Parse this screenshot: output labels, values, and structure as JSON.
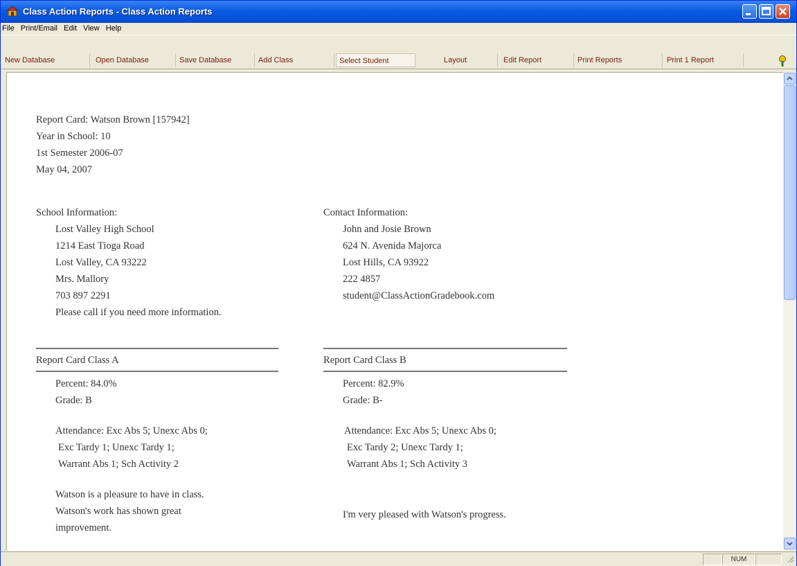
{
  "window": {
    "title": "Class Action Reports - Class Action Reports"
  },
  "menu": {
    "items": [
      "File",
      "Print/Email",
      "Edit",
      "View",
      "Help"
    ]
  },
  "toolbar": {
    "buttons": [
      "New Database",
      "Open Database",
      "Save Database",
      "Add Class",
      "Select Student",
      "Layout",
      "Edit Report",
      "Print Reports",
      "Print 1 Report"
    ],
    "selected": "Select Student"
  },
  "report": {
    "header": {
      "title_line": "Report Card: Watson Brown [157942]",
      "year_line": "Year in School: 10",
      "semester_line": "1st Semester 2006-07",
      "date_line": "May 04, 2007"
    },
    "school": {
      "heading": "School Information:",
      "lines": [
        "Lost Valley High School",
        "1214 East Tioga Road",
        "Lost Valley, CA 93222",
        "Mrs. Mallory",
        "703 897 2291",
        "Please call if you need more information."
      ]
    },
    "contact": {
      "heading": "Contact Information:",
      "lines": [
        "John and Josie Brown",
        "624 N. Avenida Majorca",
        "Lost Hills, CA 93922",
        "222 4857",
        "student@ClassActionGradebook.com"
      ]
    },
    "classes": [
      {
        "name": "Report Card Class A",
        "percent_line": "Percent:  84.0%",
        "grade_line": "Grade:  B",
        "attendance": [
          "Attendance: Exc Abs 5; Unexc Abs 0;",
          "Exc Tardy 1; Unexc Tardy 1;",
          "Warrant Abs 1; Sch Activity 2"
        ],
        "comments": [
          "Watson is a pleasure to have in class.",
          "Watson's work has shown great",
          "improvement."
        ]
      },
      {
        "name": "Report Card Class B",
        "percent_line": "Percent:  82.9%",
        "grade_line": "Grade:  B-",
        "attendance": [
          "Attendance: Exc Abs 5; Unexc Abs 0;",
          "Exc Tardy 2; Unexc Tardy 1;",
          "Warrant Abs 1; Sch Activity 3"
        ],
        "comments": [
          "I'm very pleased with Watson's progress."
        ]
      }
    ]
  },
  "status": {
    "num_indicator": "NUM"
  },
  "colors": {
    "titlebar": "#0a5ce0",
    "toolbar_text": "#7a1b12",
    "report_text": "#333333"
  }
}
